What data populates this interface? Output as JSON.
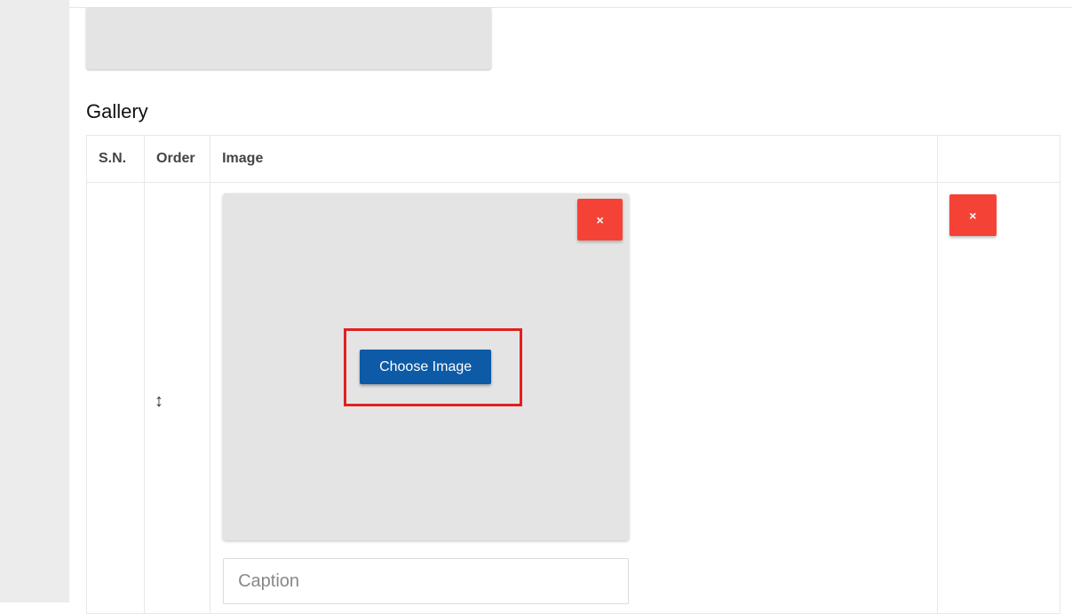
{
  "section": {
    "title": "Gallery"
  },
  "table": {
    "headers": {
      "sn": "S.N.",
      "order": "Order",
      "image": "Image",
      "action": ""
    },
    "rows": [
      {
        "sn": "",
        "order_icon": "↕",
        "choose_label": "Choose Image",
        "remove_image_label": "×",
        "caption_placeholder": "Caption",
        "caption_value": "",
        "remove_row_label": "×"
      }
    ]
  },
  "colors": {
    "danger": "#f44336",
    "primary": "#0d5aa7",
    "highlight": "#e02020",
    "image_placeholder": "#e4e4e4"
  },
  "icons": {
    "drag_handle": "drag-handle-icon",
    "remove": "close-icon"
  }
}
